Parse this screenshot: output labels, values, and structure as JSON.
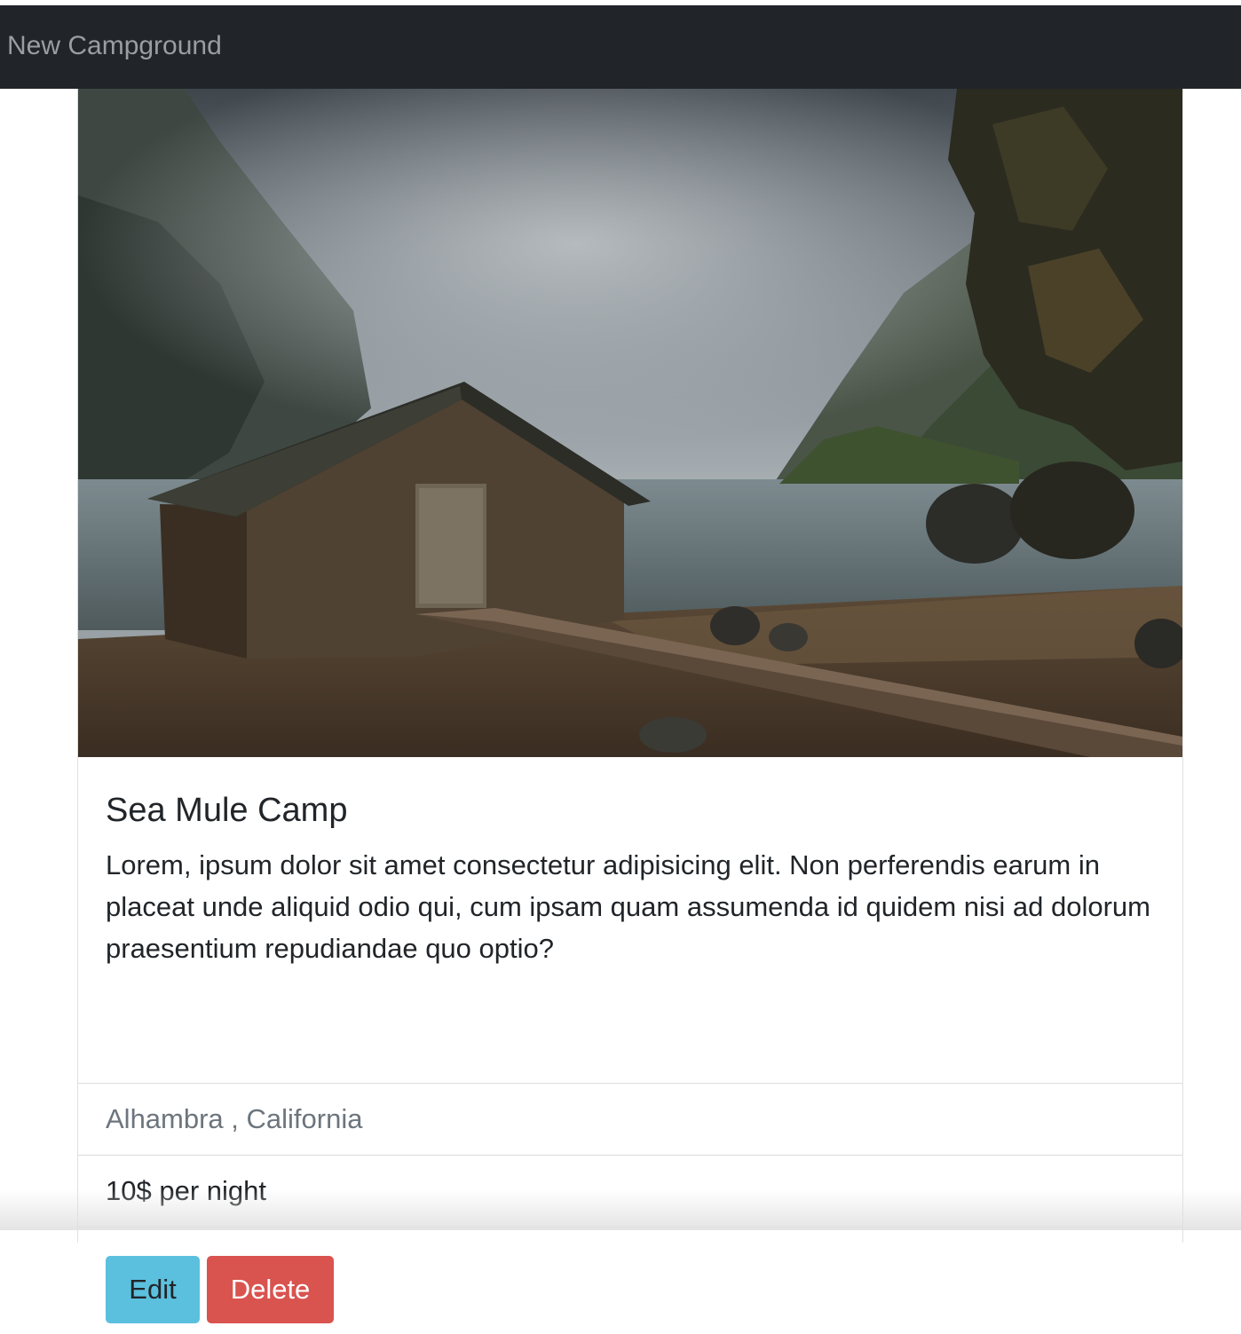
{
  "navbar": {
    "brand_label": "New Campground"
  },
  "campground": {
    "image_icon": "boathouse-photo",
    "title": "Sea Mule Camp",
    "description": "Lorem, ipsum dolor sit amet consectetur adipisicing elit. Non perferendis earum in placeat unde aliquid odio qui, cum ipsam quam assumenda id quidem nisi ad dolorum praesentium repudiandae quo optio?",
    "location": "Alhambra , California",
    "price_text": "10$ per night"
  },
  "actions": {
    "edit_label": "Edit",
    "delete_label": "Delete"
  },
  "colors": {
    "navbar_bg": "#212529",
    "edit_button": "#5bc0de",
    "delete_button": "#d9534f",
    "muted_text": "#6c757d"
  }
}
